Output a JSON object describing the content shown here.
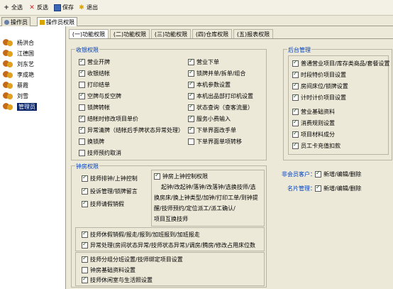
{
  "toolbar": {
    "select_all": "全选",
    "invert": "反选",
    "save": "保存",
    "exit": "退出"
  },
  "tabs": [
    "操作员",
    "操作员权限"
  ],
  "users": [
    "杨洪合",
    "江德国",
    "刘东艺",
    "李成艳",
    "蔡霞",
    "刘雪",
    "管理员"
  ],
  "subtabs": [
    "(一)功能权限",
    "(二)功能权限",
    "(三)功能权限",
    "(四)仓库权限",
    "(五)报表权限"
  ],
  "cashier": {
    "title": "收银权限",
    "col1": [
      {
        "label": "营业开牌",
        "checked": true
      },
      {
        "label": "收银结帐",
        "checked": true
      },
      {
        "label": "打印结单",
        "checked": false
      },
      {
        "label": "空牌与反空牌",
        "checked": true
      },
      {
        "label": "锁牌转帐",
        "checked": false
      },
      {
        "label": "结帐时修改项目单价",
        "checked": true
      },
      {
        "label": "异常清牌（结帐后手牌状态异常处理）",
        "checked": true
      },
      {
        "label": "换锁牌",
        "checked": false
      },
      {
        "label": "技师预约取消",
        "checked": false
      }
    ],
    "col2": [
      {
        "label": "营业下单",
        "checked": true
      },
      {
        "label": "锁牌并单/拆单/组合",
        "checked": true
      },
      {
        "label": "本机参数设置",
        "checked": true
      },
      {
        "label": "本机出品部打印机设置",
        "checked": true
      },
      {
        "label": "状态查询（查客流量）",
        "checked": true
      },
      {
        "label": "服务小费输入",
        "checked": true
      },
      {
        "label": "下单界面改手单",
        "checked": true
      },
      {
        "label": "下单界面单项转移",
        "checked": false
      }
    ]
  },
  "backoffice": {
    "title": "后台管理",
    "items": [
      {
        "label": "普通营业项目/库存类商品/套餐设置",
        "checked": true
      },
      {
        "label": "时段特价项目设置",
        "checked": true
      },
      {
        "label": "房间床位/锁牌设置",
        "checked": true
      },
      {
        "label": "计时计价项目设置",
        "checked": true
      },
      {
        "label": "营业基础资料",
        "checked": true
      },
      {
        "label": "消费规则设置",
        "checked": true
      },
      {
        "label": "项目材料成分",
        "checked": true
      },
      {
        "label": "员工卡充值扣款",
        "checked": true
      }
    ]
  },
  "tech": {
    "title": "钟房权限",
    "left": [
      {
        "label": "技师排钟/上钟控制",
        "checked": true
      },
      {
        "label": "投诉管理/锁牌留言",
        "checked": true
      },
      {
        "label": "技师请假销假",
        "checked": true
      }
    ],
    "onclock": {
      "label": "钟房上钟控制权限",
      "checked": true,
      "lines": [
        "起钟/改起钟/落钟/改落钟/选换技师/选",
        "换房床/换上钟类型/加钟/打印工单/到钟提",
        "醒/技师预约/定位派工/派工确认/",
        "项目互换技师"
      ]
    },
    "bottom": [
      {
        "label": "技师休假销假/报走/报到/加班报到/加班报走",
        "checked": true
      },
      {
        "label": "异常处理(房间状态异常/技师状态异常)/调房/腾房/修改占用床位数",
        "checked": true
      }
    ],
    "bottom2": [
      {
        "label": "技师分组分班设置/技师绑定项目设置",
        "checked": true
      },
      {
        "label": "钟房基础资料设置",
        "checked": false
      },
      {
        "label": "技师休闲室与生活照设置",
        "checked": true
      }
    ]
  },
  "extra": [
    {
      "label": "非会员客户：",
      "option": "新增/编辑/删除",
      "checked": true
    },
    {
      "label": "名片管理：",
      "option": "新增/编辑/删除",
      "checked": true
    }
  ]
}
